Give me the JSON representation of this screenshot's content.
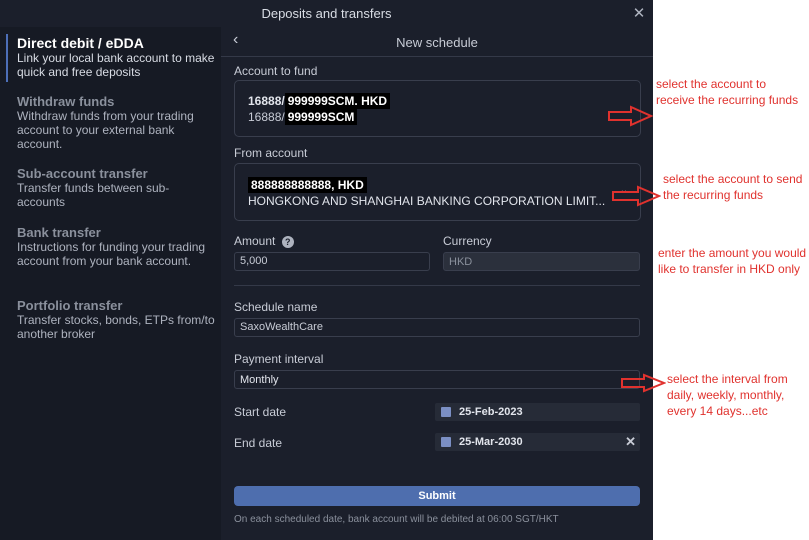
{
  "window": {
    "title": "Deposits and transfers"
  },
  "sidebar": {
    "items": [
      {
        "title": "Direct debit / eDDA",
        "desc": "Link your local bank account to make quick and free deposits"
      },
      {
        "title": "Withdraw funds",
        "desc": "Withdraw funds from your trading account to your external bank account."
      },
      {
        "title": "Sub-account transfer",
        "desc": "Transfer funds between sub-accounts"
      },
      {
        "title": "Bank transfer",
        "desc": "Instructions for funding your trading account from your bank account."
      },
      {
        "title": "Portfolio transfer",
        "desc": "Transfer stocks, bonds, ETPs from/to another broker"
      }
    ]
  },
  "schedule": {
    "title": "New schedule",
    "account_to_fund": {
      "label": "Account to fund",
      "prefix1": "16888/",
      "masked1": "999999SCM. HKD",
      "prefix2": "16888/",
      "masked2": "999999SCM"
    },
    "from_account": {
      "label": "From account",
      "number": "888888888888, HKD",
      "bank": "HONGKONG AND SHANGHAI BANKING CORPORATION LIMIT..."
    },
    "amount": {
      "label": "Amount",
      "value": "5,000"
    },
    "currency": {
      "label": "Currency",
      "value": "HKD"
    },
    "schedule_name": {
      "label": "Schedule name",
      "value": "SaxoWealthCare"
    },
    "payment_interval": {
      "label": "Payment interval",
      "value": "Monthly"
    },
    "start_date": {
      "label": "Start date",
      "value": "25-Feb-2023"
    },
    "end_date": {
      "label": "End date",
      "value": "25-Mar-2030"
    },
    "submit_label": "Submit",
    "note": "On each scheduled date, bank account will be debited at 06:00 SGT/HKT"
  },
  "annotations": {
    "a1": "select the account to receive the recurring funds",
    "a2": "select the account to send the recurring funds",
    "a3": "enter the amount you would like to transfer in HKD only",
    "a4": "select the interval from daily, weekly, monthly, every 14 days...etc"
  },
  "colors": {
    "accent": "#4e6eae",
    "annotation": "#e0322e",
    "background": "#1b1f2b"
  }
}
